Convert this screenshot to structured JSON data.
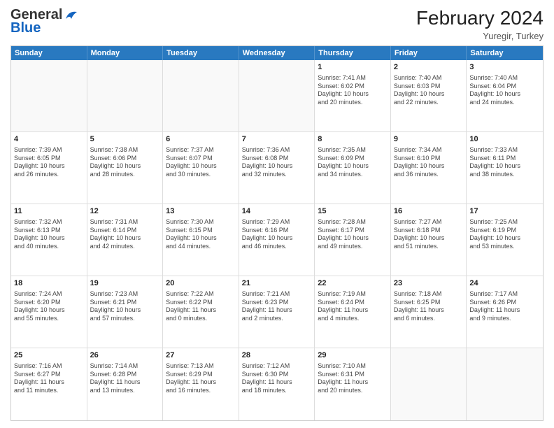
{
  "header": {
    "logo_general": "General",
    "logo_blue": "Blue",
    "month_title": "February 2024",
    "subtitle": "Yuregir, Turkey"
  },
  "days": [
    "Sunday",
    "Monday",
    "Tuesday",
    "Wednesday",
    "Thursday",
    "Friday",
    "Saturday"
  ],
  "rows": [
    [
      {
        "day": "",
        "info": "",
        "empty": true
      },
      {
        "day": "",
        "info": "",
        "empty": true
      },
      {
        "day": "",
        "info": "",
        "empty": true
      },
      {
        "day": "",
        "info": "",
        "empty": true
      },
      {
        "day": "1",
        "info": "Sunrise: 7:41 AM\nSunset: 6:02 PM\nDaylight: 10 hours\nand 20 minutes."
      },
      {
        "day": "2",
        "info": "Sunrise: 7:40 AM\nSunset: 6:03 PM\nDaylight: 10 hours\nand 22 minutes."
      },
      {
        "day": "3",
        "info": "Sunrise: 7:40 AM\nSunset: 6:04 PM\nDaylight: 10 hours\nand 24 minutes."
      }
    ],
    [
      {
        "day": "4",
        "info": "Sunrise: 7:39 AM\nSunset: 6:05 PM\nDaylight: 10 hours\nand 26 minutes."
      },
      {
        "day": "5",
        "info": "Sunrise: 7:38 AM\nSunset: 6:06 PM\nDaylight: 10 hours\nand 28 minutes."
      },
      {
        "day": "6",
        "info": "Sunrise: 7:37 AM\nSunset: 6:07 PM\nDaylight: 10 hours\nand 30 minutes."
      },
      {
        "day": "7",
        "info": "Sunrise: 7:36 AM\nSunset: 6:08 PM\nDaylight: 10 hours\nand 32 minutes."
      },
      {
        "day": "8",
        "info": "Sunrise: 7:35 AM\nSunset: 6:09 PM\nDaylight: 10 hours\nand 34 minutes."
      },
      {
        "day": "9",
        "info": "Sunrise: 7:34 AM\nSunset: 6:10 PM\nDaylight: 10 hours\nand 36 minutes."
      },
      {
        "day": "10",
        "info": "Sunrise: 7:33 AM\nSunset: 6:11 PM\nDaylight: 10 hours\nand 38 minutes."
      }
    ],
    [
      {
        "day": "11",
        "info": "Sunrise: 7:32 AM\nSunset: 6:13 PM\nDaylight: 10 hours\nand 40 minutes."
      },
      {
        "day": "12",
        "info": "Sunrise: 7:31 AM\nSunset: 6:14 PM\nDaylight: 10 hours\nand 42 minutes."
      },
      {
        "day": "13",
        "info": "Sunrise: 7:30 AM\nSunset: 6:15 PM\nDaylight: 10 hours\nand 44 minutes."
      },
      {
        "day": "14",
        "info": "Sunrise: 7:29 AM\nSunset: 6:16 PM\nDaylight: 10 hours\nand 46 minutes."
      },
      {
        "day": "15",
        "info": "Sunrise: 7:28 AM\nSunset: 6:17 PM\nDaylight: 10 hours\nand 49 minutes."
      },
      {
        "day": "16",
        "info": "Sunrise: 7:27 AM\nSunset: 6:18 PM\nDaylight: 10 hours\nand 51 minutes."
      },
      {
        "day": "17",
        "info": "Sunrise: 7:25 AM\nSunset: 6:19 PM\nDaylight: 10 hours\nand 53 minutes."
      }
    ],
    [
      {
        "day": "18",
        "info": "Sunrise: 7:24 AM\nSunset: 6:20 PM\nDaylight: 10 hours\nand 55 minutes."
      },
      {
        "day": "19",
        "info": "Sunrise: 7:23 AM\nSunset: 6:21 PM\nDaylight: 10 hours\nand 57 minutes."
      },
      {
        "day": "20",
        "info": "Sunrise: 7:22 AM\nSunset: 6:22 PM\nDaylight: 11 hours\nand 0 minutes."
      },
      {
        "day": "21",
        "info": "Sunrise: 7:21 AM\nSunset: 6:23 PM\nDaylight: 11 hours\nand 2 minutes."
      },
      {
        "day": "22",
        "info": "Sunrise: 7:19 AM\nSunset: 6:24 PM\nDaylight: 11 hours\nand 4 minutes."
      },
      {
        "day": "23",
        "info": "Sunrise: 7:18 AM\nSunset: 6:25 PM\nDaylight: 11 hours\nand 6 minutes."
      },
      {
        "day": "24",
        "info": "Sunrise: 7:17 AM\nSunset: 6:26 PM\nDaylight: 11 hours\nand 9 minutes."
      }
    ],
    [
      {
        "day": "25",
        "info": "Sunrise: 7:16 AM\nSunset: 6:27 PM\nDaylight: 11 hours\nand 11 minutes."
      },
      {
        "day": "26",
        "info": "Sunrise: 7:14 AM\nSunset: 6:28 PM\nDaylight: 11 hours\nand 13 minutes."
      },
      {
        "day": "27",
        "info": "Sunrise: 7:13 AM\nSunset: 6:29 PM\nDaylight: 11 hours\nand 16 minutes."
      },
      {
        "day": "28",
        "info": "Sunrise: 7:12 AM\nSunset: 6:30 PM\nDaylight: 11 hours\nand 18 minutes."
      },
      {
        "day": "29",
        "info": "Sunrise: 7:10 AM\nSunset: 6:31 PM\nDaylight: 11 hours\nand 20 minutes."
      },
      {
        "day": "",
        "info": "",
        "empty": true
      },
      {
        "day": "",
        "info": "",
        "empty": true
      }
    ]
  ]
}
